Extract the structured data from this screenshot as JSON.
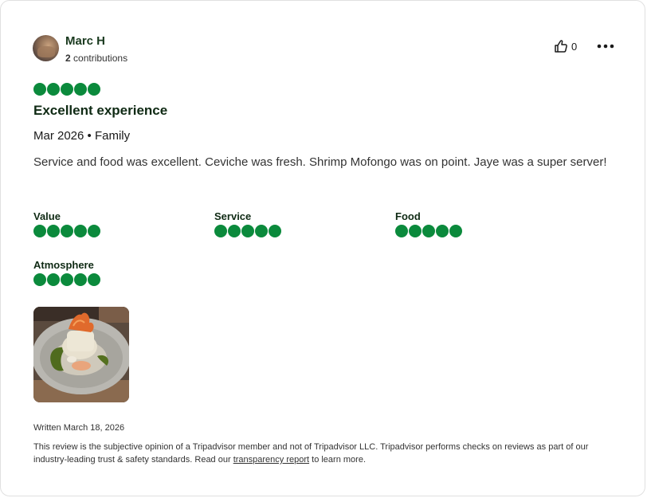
{
  "reviewer": {
    "name": "Marc H",
    "contributions_count": "2",
    "contributions_label": "contributions",
    "avatar_icon": "avatar-photo"
  },
  "actions": {
    "helpful_icon": "thumbs-up-icon",
    "helpful_count": "0",
    "more_icon": "more-options-icon"
  },
  "review": {
    "rating": 5,
    "rating_max": 5,
    "title": "Excellent experience",
    "meta": "Mar 2026 • Family",
    "body": "Service and food was excellent. Ceviche was fresh. Shrimp Mofongo was on point. Jaye was a super server!"
  },
  "subratings": [
    {
      "label": "Value",
      "rating": 5
    },
    {
      "label": "Service",
      "rating": 5
    },
    {
      "label": "Food",
      "rating": 5
    },
    {
      "label": "Atmosphere",
      "rating": 5
    }
  ],
  "photo": {
    "icon": "food-photo"
  },
  "footer": {
    "written": "Written March 18, 2026",
    "disclaimer_before": "This review is the subjective opinion of a Tripadvisor member and not of Tripadvisor LLC. Tripadvisor performs checks on reviews as part of our industry-leading trust & safety standards. Read our ",
    "disclaimer_link": "transparency report",
    "disclaimer_after": " to learn more."
  },
  "colors": {
    "bubble": "#0b8a3c",
    "title": "#0f2a14"
  }
}
